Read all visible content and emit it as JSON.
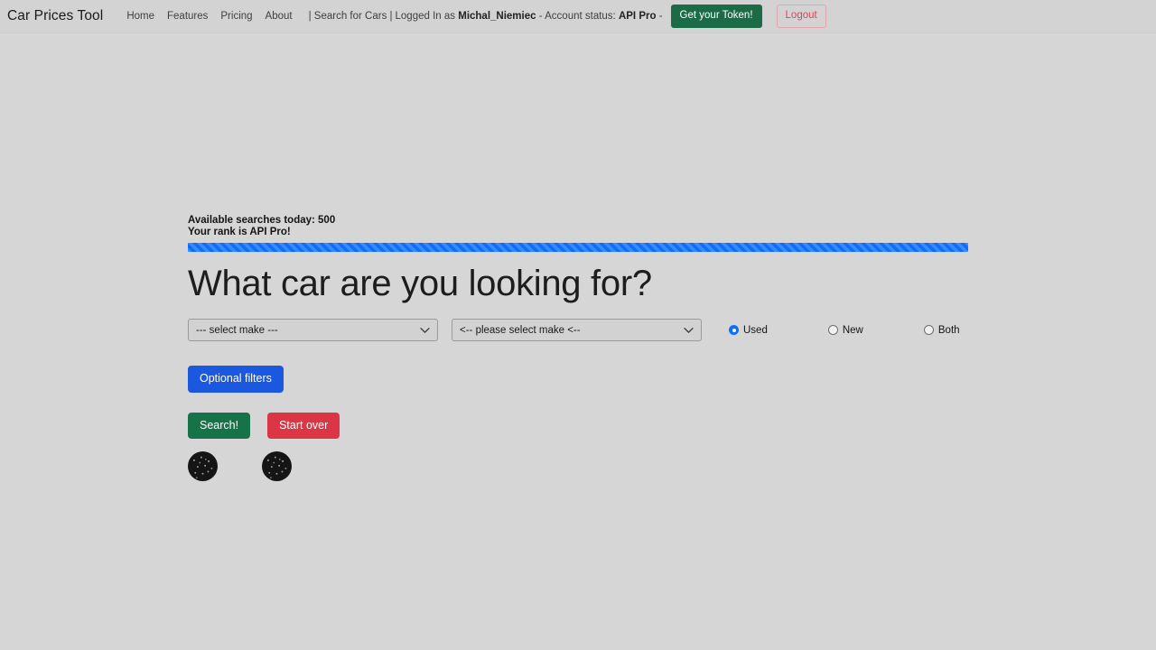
{
  "navbar": {
    "brand": "Car Prices Tool",
    "links": [
      {
        "label": "Home",
        "name": "nav-link-home"
      },
      {
        "label": "Features",
        "name": "nav-link-features"
      },
      {
        "label": "Pricing",
        "name": "nav-link-pricing"
      },
      {
        "label": "About",
        "name": "nav-link-about"
      }
    ],
    "search_label": "| Search for Cars |",
    "logged_in_prefix": "Logged In as",
    "username": "Michal_Niemiec",
    "account_status_prefix": "- Account status:",
    "account_status": "API Pro",
    "account_status_suffix": "-",
    "token_button": "Get your Token!",
    "logout_button": "Logout",
    "colors": {
      "token_button_bg": "#1b6b46",
      "logout_border": "#e7a3b0",
      "logout_text": "#d9455f",
      "navbar_bg": "#d3d3d4"
    }
  },
  "main": {
    "quota_line_1": "Available searches today: 500",
    "quota_line_2": "Your rank is API Pro!",
    "progress": {
      "value": 100,
      "striped": true,
      "color": "#0d6efd"
    },
    "headline": "What car are you looking for?",
    "make_select": {
      "selected": "--- select make ---",
      "icon": "chevron-down-icon"
    },
    "model_select": {
      "selected": "<-- please select make <--",
      "icon": "chevron-down-icon"
    },
    "condition_radios": [
      {
        "label": "Used",
        "checked": true
      },
      {
        "label": "New",
        "checked": false
      },
      {
        "label": "Both",
        "checked": false
      }
    ],
    "optional_filters_button": "Optional filters",
    "search_button": "Search!",
    "start_over_button": "Start over",
    "colors": {
      "optional_filters_bg": "#1a58e0",
      "search_bg": "#157347",
      "start_over_bg": "#dc3545",
      "page_bg": "#d6d6d6"
    }
  }
}
